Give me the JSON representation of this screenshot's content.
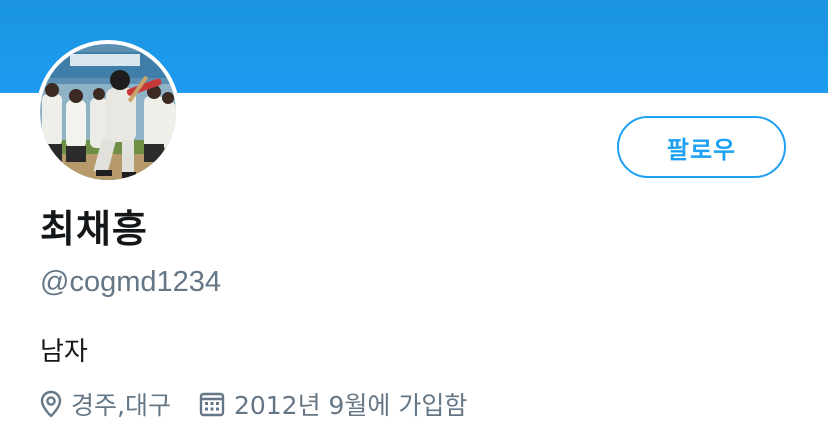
{
  "profile": {
    "display_name": "최채흥",
    "handle": "@cogmd1234",
    "bio": "남자",
    "location": "경주,대구",
    "joined": "2012년 9월에 가입함"
  },
  "actions": {
    "follow_label": "팔로우"
  },
  "icons": {
    "location": "location-pin-icon",
    "joined": "calendar-icon"
  },
  "colors": {
    "banner": "#1d9bf0",
    "accent": "#1da1f2",
    "name_text": "#14171a",
    "secondary_text": "#657786"
  }
}
